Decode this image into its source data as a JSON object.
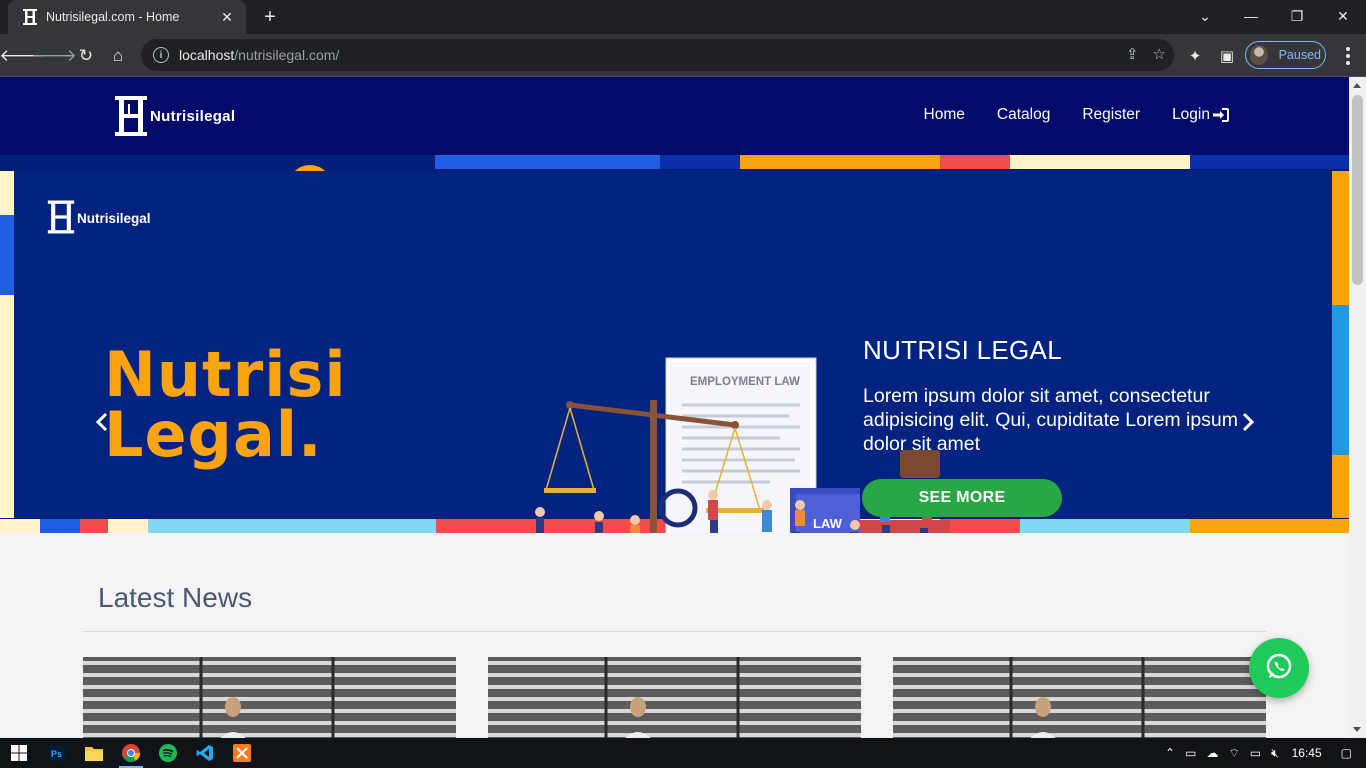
{
  "browser": {
    "tab_title": "Nutrisilegal.com - Home",
    "url_host": "localhost",
    "url_path": "/nutrisilegal.com/",
    "profile_status": "Paused"
  },
  "site": {
    "brand": "Nutrisilegal",
    "nav": [
      "Home",
      "Catalog",
      "Register",
      "Login"
    ]
  },
  "hero": {
    "logo_text": "Nutrisilegal",
    "big_title_line1": "Nutrisi",
    "big_title_line2": "Legal.",
    "doc_title": "EMPLOYMENT LAW",
    "book_label": "LAW",
    "caption_title": "NUTRISI LEGAL",
    "caption_text": "Lorem ipsum dolor sit amet, consectetur adipisicing elit. Qui, cupiditate Lorem ipsum dolor sit amet",
    "cta": "SEE MORE"
  },
  "news": {
    "title": "Latest News",
    "cards": [
      "news-1",
      "news-2",
      "news-3"
    ]
  },
  "taskbar": {
    "time": "16:45",
    "apps": [
      "windows-start-icon",
      "photoshop-icon",
      "file-explorer-icon",
      "chrome-icon",
      "spotify-icon",
      "vscode-icon",
      "xampp-icon"
    ]
  },
  "colors": {
    "nav_bg": "#020b6b",
    "hero_bg": "#02237f",
    "accent_orange": "#fca311",
    "cta_green": "#27a844",
    "whatsapp_green": "#1fc95a"
  }
}
